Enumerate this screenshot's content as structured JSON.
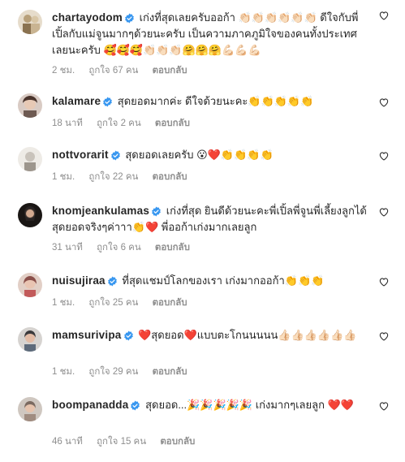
{
  "comments": [
    {
      "username": "chartayodom",
      "text": "เก่งที่สุดเลยครับออก้า 👏🏻👏🏻👏🏻👏🏻👏🏻👏🏻 ดีใจกับพี่เปิ้ลกับแม่จูนมากๆด้วยนะครับ เป็นความภาคภูมิใจของคนทั้งประเทศเลยนะครับ 🥰🥰🥰👏🏻👏🏻👏🏻🤗🤗🤗💪🏻💪🏻💪🏻",
      "time": "2 ชม.",
      "likes": "ถูกใจ 67 คน",
      "reply": "ตอบกลับ",
      "avatar_color": "#b8a07a"
    },
    {
      "username": "kalamare",
      "text": "สุดยอดมากค่ะ ดีใจด้วยนะคะ👏👏👏👏👏",
      "time": "18 นาที",
      "likes": "ถูกใจ 2 คน",
      "reply": "ตอบกลับ",
      "avatar_color": "#6e5a52"
    },
    {
      "username": "nottvorarit",
      "text": "สุดยอดเลยครับ 😮❤️👏👏👏👏",
      "time": "1 ชม.",
      "likes": "ถูกใจ 22 คน",
      "reply": "ตอบกลับ",
      "avatar_color": "#c9c3bb"
    },
    {
      "username": "knomjeankulamas",
      "text": "เก่งที่สุด ยินดีด้วยนะคะพี่เปิ้ลพี่จูนพี่เลี้ยงลูกได้สุดยอดจริงๆค่าาา👏❤️ พี่ออก้าเก่งมากเลยลูก",
      "time": "31 นาที",
      "likes": "ถูกใจ 6 คน",
      "reply": "ตอบกลับ",
      "avatar_color": "#2c2624"
    },
    {
      "username": "nuisujiraa",
      "text": "ที่สุดแชมป์โลกของเรา เก่งมากออก้า👏👏👏",
      "time": "1 ชม.",
      "likes": "ถูกใจ 25 คน",
      "reply": "ตอบกลับ",
      "avatar_color": "#8a4f4a"
    },
    {
      "username": "mamsurivipa",
      "text": "❤️สุดยอด❤️แบบตะโกนนนนน👍🏻👍🏻👍🏻👍🏻👍🏻👍🏻",
      "time": "1 ชม.",
      "likes": "ถูกใจ 29 คน",
      "reply": "ตอบกลับ",
      "avatar_color": "#3b3a3c"
    },
    {
      "username": "boompanadda",
      "text": "สุดยอด...🎉🎉🎉🎉🎉 เก่งมากๆเลยลูก ❤️❤️",
      "time": "46 นาที",
      "likes": "ถูกใจ 15 คน",
      "reply": "ตอบกลับ",
      "avatar_color": "#7b6a60"
    }
  ],
  "colors": {
    "verified_blue": "#3897f0",
    "meta_gray": "#8e8e8e",
    "text": "#262626"
  },
  "icons": {
    "verified": "verified-badge-icon",
    "like": "heart-outline-icon"
  }
}
